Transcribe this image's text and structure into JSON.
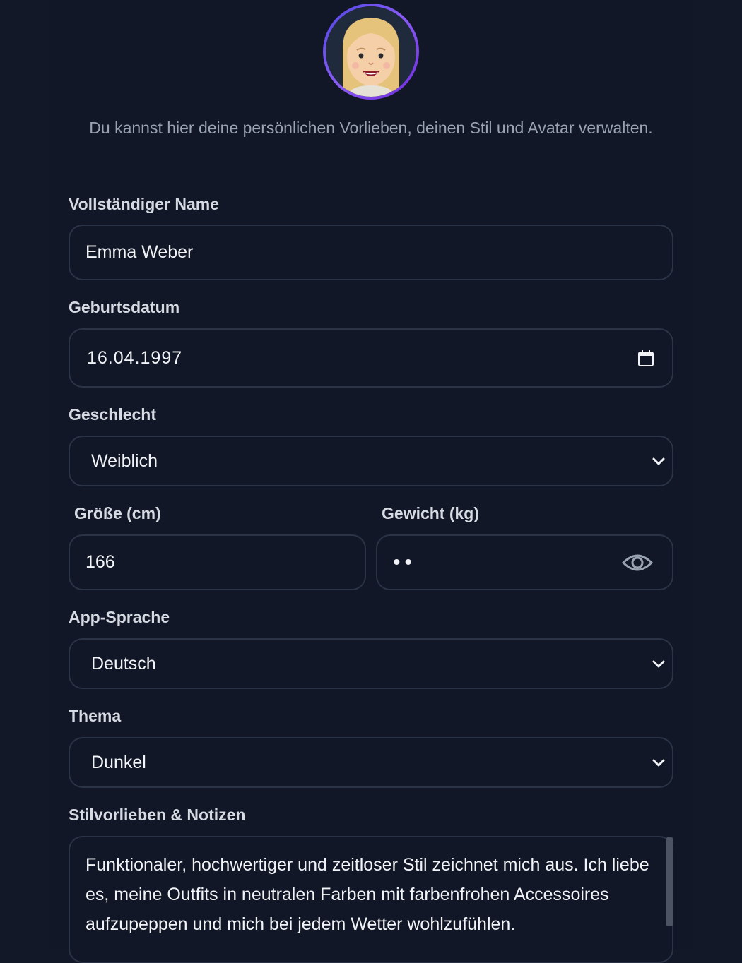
{
  "intro_text": "Du kannst hier deine persönlichen Vorlieben, deinen Stil und Avatar verwalten.",
  "fields": {
    "name": {
      "label": "Vollständiger Name",
      "value": "Emma Weber"
    },
    "birthdate": {
      "label": "Geburtsdatum",
      "value": "16.04.1997"
    },
    "gender": {
      "label": "Geschlecht",
      "value": "Weiblich"
    },
    "height": {
      "label": "Größe (cm)",
      "value": "166"
    },
    "weight": {
      "label": "Gewicht (kg)",
      "value": "••"
    },
    "language": {
      "label": "App-Sprache",
      "value": "Deutsch"
    },
    "theme": {
      "label": "Thema",
      "value": "Dunkel"
    },
    "notes": {
      "label": "Stilvorlieben & Notizen",
      "value": "Funktionaler, hochwertiger und zeitloser Stil zeichnet mich aus. Ich liebe es, meine Outfits in neutralen Farben mit farbenfrohen Accessoires aufzupeppen und mich bei jedem Wetter wohlzufühlen."
    }
  },
  "icons": {
    "avatar": "avatar-woman",
    "calendar": "calendar-icon",
    "chevron": "chevron-down-icon",
    "eye": "eye-icon"
  },
  "colors": {
    "background": "#111726",
    "field_border": "#2b3446",
    "accent": "#6d28d9"
  }
}
